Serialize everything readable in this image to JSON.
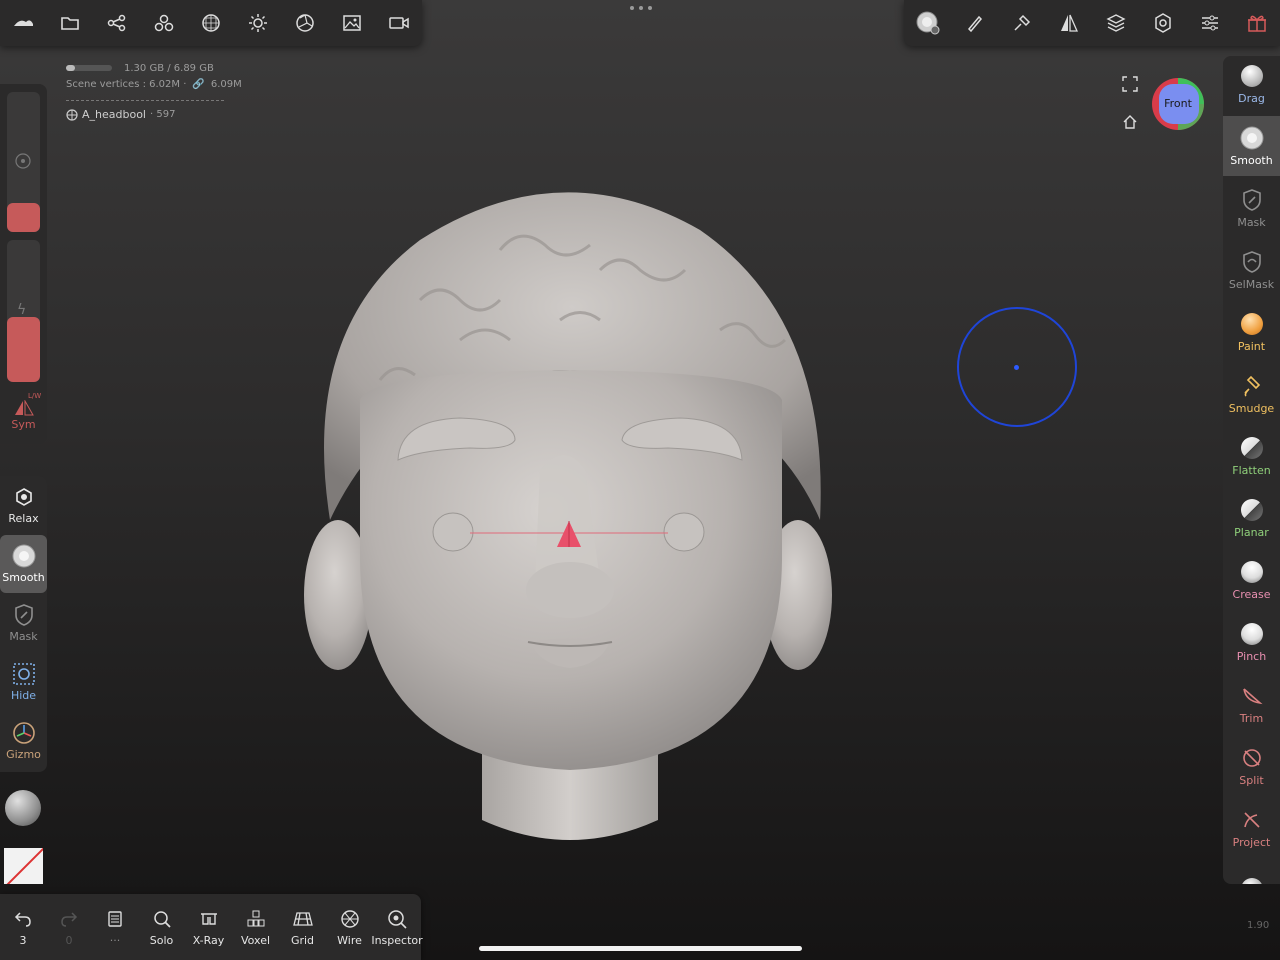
{
  "top_left_toolbar": {
    "icons": [
      "nomad-logo-icon",
      "folder-icon",
      "scene-graph-icon",
      "meshes-icon",
      "topology-icon",
      "light-icon",
      "shading-icon",
      "background-icon",
      "camera-icon"
    ]
  },
  "top_right_toolbar": {
    "icons": [
      "smooth-brush-icon",
      "paint-brush-icon",
      "stroke-icon",
      "symmetry-icon",
      "layers-icon",
      "settings-icon",
      "preferences-icon",
      "gift-icon"
    ]
  },
  "stats": {
    "memory": "1.30 GB / 6.89 GB",
    "memory_fraction": 0.19,
    "vertices": "Scene vertices : 6.02M · ",
    "vertices_link": "6.09M"
  },
  "object": {
    "name": "A_headbool",
    "count": "· 597"
  },
  "left_panel": {
    "radius_fraction": 0.21,
    "intensity_fraction": 0.46,
    "sym_label": "Sym",
    "sym_tag": "L/W"
  },
  "left_tools": [
    {
      "name": "relax",
      "label": "Relax",
      "color": "#e8e8e8",
      "icon": "relax-icon"
    },
    {
      "name": "smooth",
      "label": "Smooth",
      "color": "#ffffff",
      "icon": "smooth-icon",
      "active": true
    },
    {
      "name": "mask",
      "label": "Mask",
      "color": "#8f8f8f",
      "icon": "mask-icon"
    },
    {
      "name": "hide",
      "label": "Hide",
      "color": "#7fb0e8",
      "icon": "hide-icon"
    },
    {
      "name": "gizmo",
      "label": "Gizmo",
      "color": "#c9a27a",
      "icon": "gizmo-icon"
    }
  ],
  "bottom_bar": {
    "undo_count": "3",
    "redo_count": "0",
    "items": [
      {
        "name": "solo",
        "label": "Solo"
      },
      {
        "name": "xray",
        "label": "X-Ray"
      },
      {
        "name": "voxel",
        "label": "Voxel"
      },
      {
        "name": "grid",
        "label": "Grid"
      },
      {
        "name": "wire",
        "label": "Wire"
      },
      {
        "name": "inspector",
        "label": "Inspector"
      }
    ]
  },
  "viewcube": {
    "label": "Front"
  },
  "right_tools": [
    {
      "name": "drag",
      "label": "Drag",
      "color": "#9bb8e8"
    },
    {
      "name": "smooth",
      "label": "Smooth",
      "color": "#ffffff",
      "active": true
    },
    {
      "name": "mask",
      "label": "Mask",
      "color": "#8f8f8f"
    },
    {
      "name": "selmask",
      "label": "SelMask",
      "color": "#8f8f8f"
    },
    {
      "name": "paint",
      "label": "Paint",
      "color": "#f0c060"
    },
    {
      "name": "smudge",
      "label": "Smudge",
      "color": "#f0c060"
    },
    {
      "name": "flatten",
      "label": "Flatten",
      "color": "#8fcf7a"
    },
    {
      "name": "planar",
      "label": "Planar",
      "color": "#8fcf7a"
    },
    {
      "name": "crease",
      "label": "Crease",
      "color": "#e88fb0"
    },
    {
      "name": "pinch",
      "label": "Pinch",
      "color": "#e88fb0"
    },
    {
      "name": "trim",
      "label": "Trim",
      "color": "#d98080"
    },
    {
      "name": "split",
      "label": "Split",
      "color": "#d98080"
    },
    {
      "name": "project",
      "label": "Project",
      "color": "#d98080"
    }
  ],
  "version": "1.90"
}
